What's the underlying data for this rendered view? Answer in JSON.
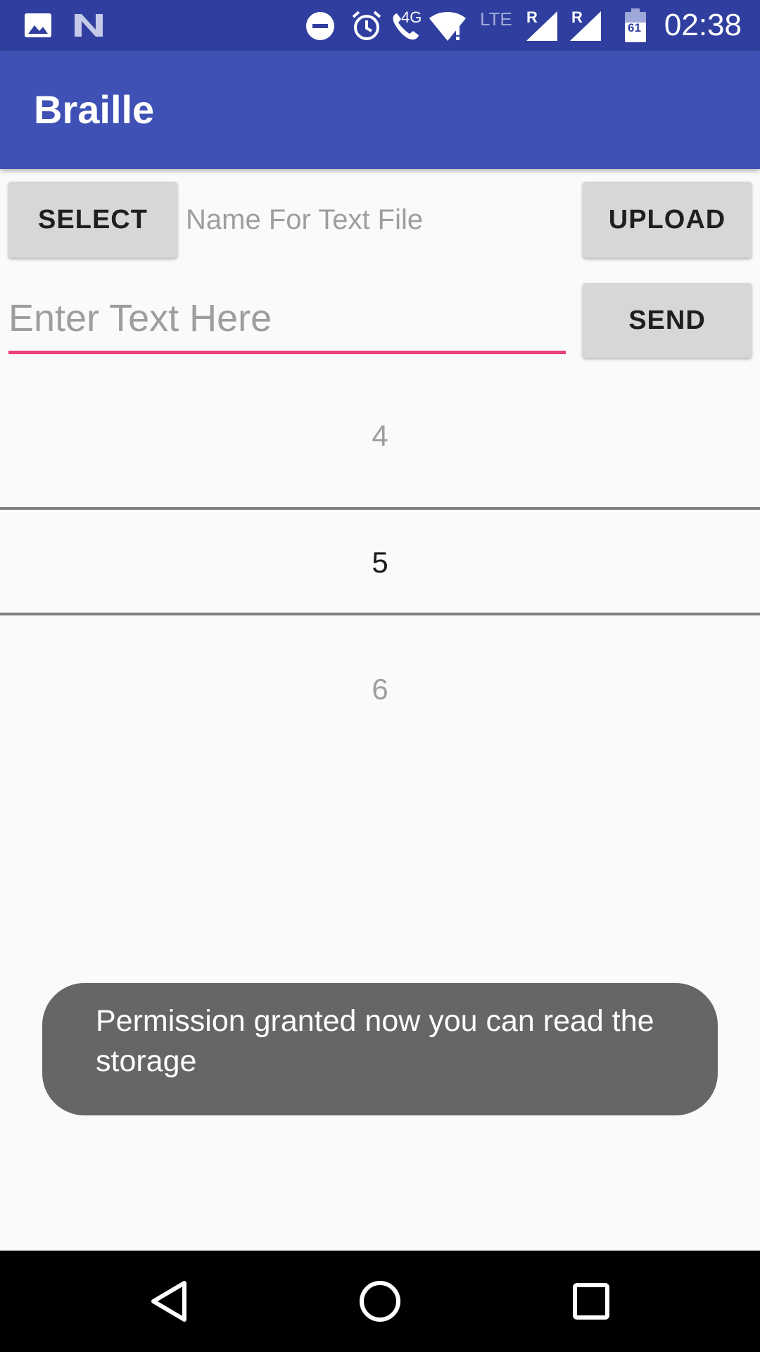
{
  "status_bar": {
    "time": "02:38",
    "network_label": "4G",
    "lte_label": "LTE",
    "roaming_label_1": "R",
    "roaming_label_2": "R",
    "battery_level_text": "61",
    "icons": [
      "image-icon",
      "n-icon",
      "do-not-disturb-icon",
      "alarm-icon",
      "wifi-call-icon",
      "wifi-icon",
      "signal-icon",
      "signal-icon",
      "battery-icon"
    ]
  },
  "app_bar": {
    "title": "Braille"
  },
  "toolbar": {
    "select_label": "SELECT",
    "filename_placeholder": "Name For Text File",
    "upload_label": "UPLOAD"
  },
  "composer": {
    "text_placeholder": "Enter Text Here",
    "text_value": "",
    "send_label": "SEND"
  },
  "picker": {
    "previous": "4",
    "current": "5",
    "next": "6"
  },
  "toast": {
    "message": "Permission granted now you can read the storage"
  },
  "nav_bar": {
    "buttons": [
      "back-icon",
      "home-icon",
      "recents-icon"
    ]
  },
  "colors": {
    "status_bar": "#303f9f",
    "app_bar": "#3f51b5",
    "accent": "#ec407a",
    "button": "#d6d7d7",
    "toast": "#666666",
    "background": "#fafafa"
  }
}
